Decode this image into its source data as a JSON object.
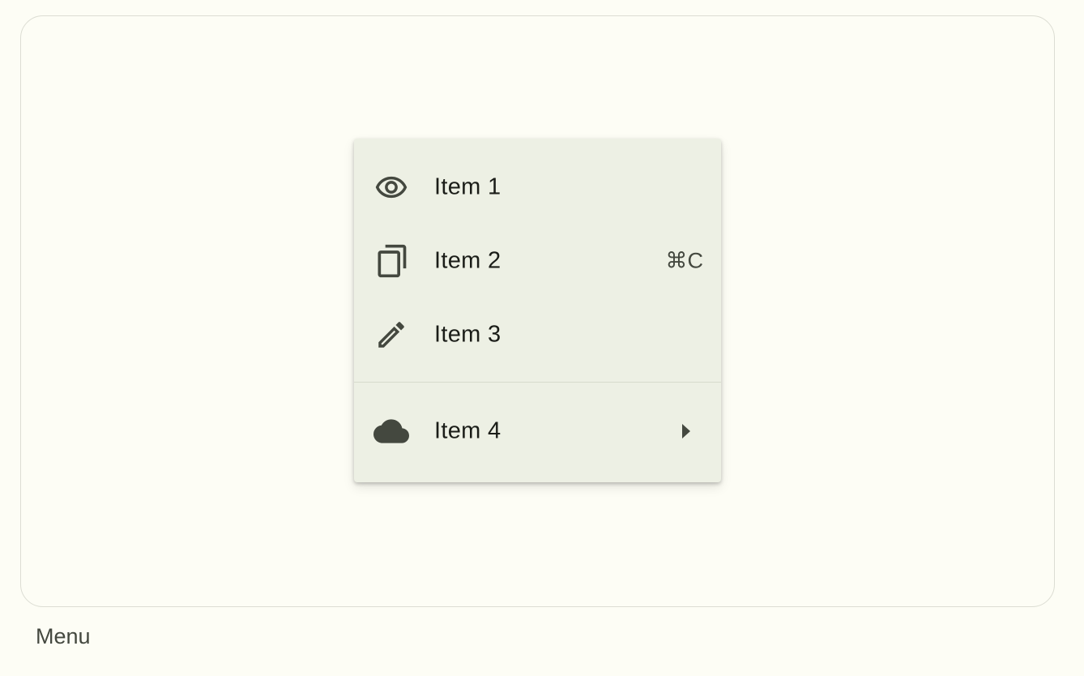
{
  "menu": {
    "items": [
      {
        "label": "Item 1",
        "icon": "eye-icon",
        "shortcut": ""
      },
      {
        "label": "Item 2",
        "icon": "copy-icon",
        "shortcut": "⌘C"
      },
      {
        "label": "Item 3",
        "icon": "pencil-icon",
        "shortcut": ""
      },
      {
        "label": "Item 4",
        "icon": "cloud-icon",
        "submenu": true
      }
    ]
  },
  "caption": "Menu",
  "colors": {
    "background": "#fdfdf5",
    "menu_surface": "#edf0e4",
    "icon": "#44483f",
    "text": "#1b1d18"
  }
}
